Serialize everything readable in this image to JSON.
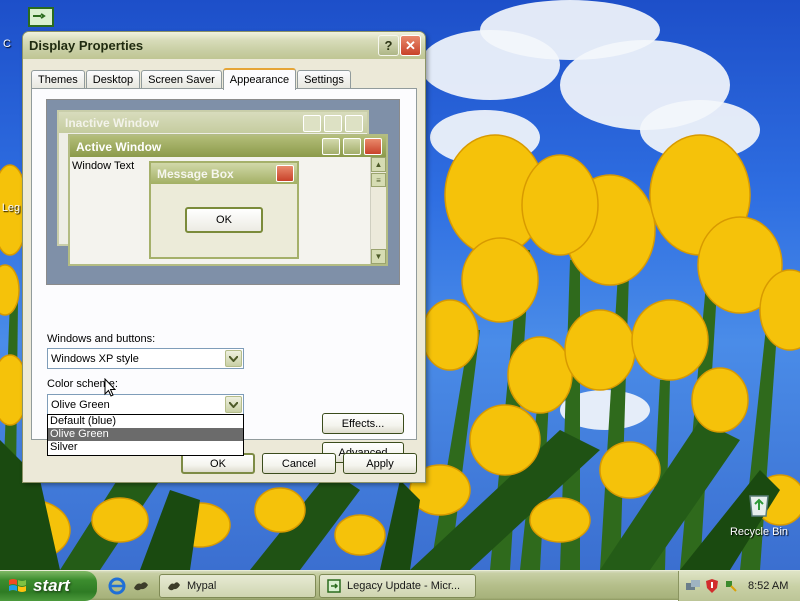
{
  "desktop": {
    "icons": [
      {
        "label": "C"
      },
      {
        "label": "Leg"
      },
      {
        "label": "Recycle Bin"
      }
    ]
  },
  "dialog": {
    "title": "Display Properties",
    "help_glyph": "?",
    "close_glyph": "✕",
    "tabs": [
      "Themes",
      "Desktop",
      "Screen Saver",
      "Appearance",
      "Settings"
    ],
    "active_tab": "Appearance",
    "preview": {
      "inactive_title": "Inactive Window",
      "active_title": "Active Window",
      "window_text": "Window Text",
      "message_box_title": "Message Box",
      "message_box_ok": "OK"
    },
    "windows_buttons_label": "Windows and buttons:",
    "windows_buttons_value": "Windows XP style",
    "color_scheme_label": "Color scheme:",
    "color_scheme_value": "Olive Green",
    "color_scheme_options": [
      "Default (blue)",
      "Olive Green",
      "Silver"
    ],
    "selected_option": "Olive Green",
    "effects_label": "Effects...",
    "advanced_label": "Advanced",
    "ok_label": "OK",
    "cancel_label": "Cancel",
    "apply_label": "Apply"
  },
  "taskbar": {
    "start_label": "start",
    "tasks": [
      {
        "label": "Mypal"
      },
      {
        "label": "Legacy Update - Micr..."
      }
    ],
    "clock": "8:52 AM"
  },
  "colors": {
    "active_title": "#8b9a4a",
    "inactive_title": "#c5cc9f",
    "message_title": "#a3b064",
    "close_red": "#c8422a",
    "start_green": "#3c8d2e"
  }
}
